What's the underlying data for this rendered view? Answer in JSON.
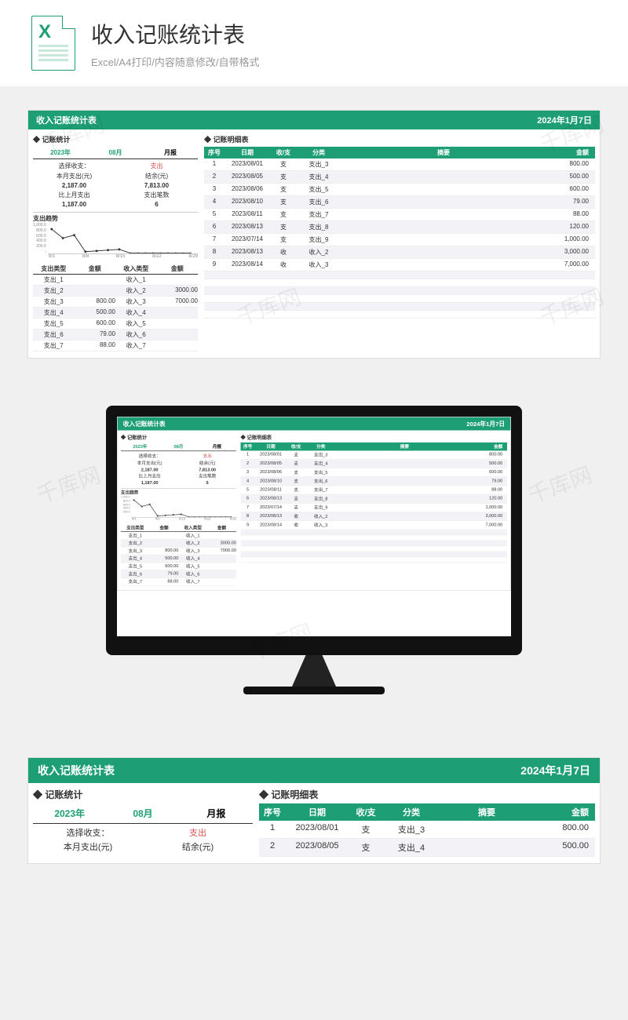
{
  "page": {
    "title": "收入记账统计表",
    "subtitle": "Excel/A4打印/内容随意修改/自带格式",
    "watermark": "千库网"
  },
  "sheet": {
    "title": "收入记账统计表",
    "date": "2024年1月7日",
    "stats_label": "◆ 记账统计",
    "detail_label": "◆ 记账明细表",
    "year": "2023年",
    "month": "08月",
    "report": "月报",
    "select_label": "选择收支：",
    "select_value": "支出",
    "this_month_label": "本月支出(元)",
    "balance_label": "结余(元)",
    "this_month_value": "2,187.00",
    "balance_value": "7,813.00",
    "vs_last_label": "比上月支出",
    "count_label": "支出笔数",
    "vs_last_value": "1,187.00",
    "count_value": "6",
    "trend_title": "支出趋势",
    "chart_y": [
      "1,000.0",
      "800.0",
      "600.0",
      "400.0",
      "200.0",
      "-"
    ],
    "chart_x": [
      "8/1",
      "8/8",
      "8/15",
      "8/22",
      "8/29"
    ],
    "type_headers": [
      "支出类型",
      "金额",
      "收入类型",
      "金额"
    ],
    "types": [
      {
        "out": "支出_1",
        "out_amt": "",
        "in": "收入_1",
        "in_amt": ""
      },
      {
        "out": "支出_2",
        "out_amt": "",
        "in": "收入_2",
        "in_amt": "3000.00"
      },
      {
        "out": "支出_3",
        "out_amt": "800.00",
        "in": "收入_3",
        "in_amt": "7000.00"
      },
      {
        "out": "支出_4",
        "out_amt": "500.00",
        "in": "收入_4",
        "in_amt": ""
      },
      {
        "out": "支出_5",
        "out_amt": "600.00",
        "in": "收入_5",
        "in_amt": ""
      },
      {
        "out": "支出_6",
        "out_amt": "79.00",
        "in": "收入_6",
        "in_amt": ""
      },
      {
        "out": "支出_7",
        "out_amt": "88.00",
        "in": "收入_7",
        "in_amt": ""
      }
    ],
    "detail_headers": {
      "seq": "序号",
      "date": "日期",
      "io": "收/支",
      "cat": "分类",
      "sum": "摘要",
      "amt": "金额"
    },
    "details": [
      {
        "seq": "1",
        "date": "2023/08/01",
        "io": "支",
        "cat": "支出_3",
        "sum": "",
        "amt": "800.00"
      },
      {
        "seq": "2",
        "date": "2023/08/05",
        "io": "支",
        "cat": "支出_4",
        "sum": "",
        "amt": "500.00"
      },
      {
        "seq": "3",
        "date": "2023/08/06",
        "io": "支",
        "cat": "支出_5",
        "sum": "",
        "amt": "600.00"
      },
      {
        "seq": "4",
        "date": "2023/08/10",
        "io": "支",
        "cat": "支出_6",
        "sum": "",
        "amt": "79.00"
      },
      {
        "seq": "5",
        "date": "2023/08/11",
        "io": "支",
        "cat": "支出_7",
        "sum": "",
        "amt": "88.00"
      },
      {
        "seq": "6",
        "date": "2023/08/13",
        "io": "支",
        "cat": "支出_8",
        "sum": "",
        "amt": "120.00"
      },
      {
        "seq": "7",
        "date": "2023/07/14",
        "io": "支",
        "cat": "支出_9",
        "sum": "",
        "amt": "1,000.00"
      },
      {
        "seq": "8",
        "date": "2023/08/13",
        "io": "收",
        "cat": "收入_2",
        "sum": "",
        "amt": "3,000.00"
      },
      {
        "seq": "9",
        "date": "2023/08/14",
        "io": "收",
        "cat": "收入_3",
        "sum": "",
        "amt": "7,000.00"
      }
    ]
  },
  "chart_data": {
    "type": "line",
    "title": "支出趋势",
    "x": [
      "8/1",
      "8/5",
      "8/6",
      "8/8",
      "8/10",
      "8/11",
      "8/13",
      "8/15",
      "8/22",
      "8/29"
    ],
    "values": [
      800,
      500,
      600,
      0,
      79,
      88,
      120,
      0,
      0,
      0
    ],
    "xlabel": "",
    "ylabel": "",
    "ylim": [
      0,
      1000
    ]
  }
}
